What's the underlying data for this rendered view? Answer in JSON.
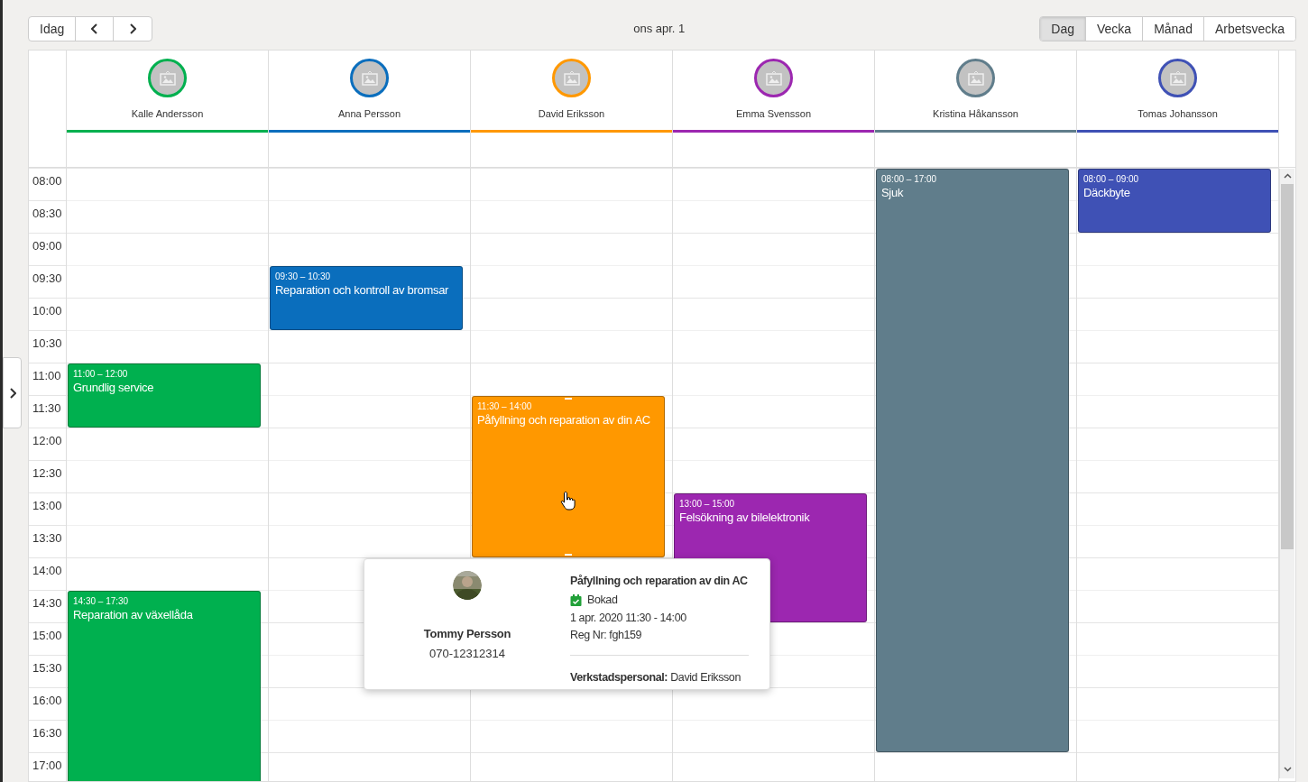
{
  "toolbar": {
    "today_button": "Idag",
    "date_label": "ons apr. 1",
    "views": [
      {
        "label": "Dag",
        "selected": true
      },
      {
        "label": "Vecka",
        "selected": false
      },
      {
        "label": "Månad",
        "selected": false
      },
      {
        "label": "Arbetsvecka",
        "selected": false
      }
    ]
  },
  "time_slots": [
    "08:00",
    "08:30",
    "09:00",
    "09:30",
    "10:00",
    "10:30",
    "11:00",
    "11:30",
    "12:00",
    "12:30",
    "13:00",
    "13:30",
    "14:00",
    "14:30",
    "15:00",
    "15:30",
    "16:00",
    "16:30",
    "17:00"
  ],
  "resources": [
    {
      "name": "Kalle Andersson",
      "color": "#00b04f",
      "events": [
        {
          "time": "11:00 – 12:00",
          "title": "Grundlig service"
        },
        {
          "time": "14:30 – 17:30",
          "title": "Reparation av växellåda"
        }
      ]
    },
    {
      "name": "Anna Persson",
      "color": "#0a6ebd",
      "events": [
        {
          "time": "09:30 – 10:30",
          "title": "Reparation och kontroll av bromsar"
        }
      ]
    },
    {
      "name": "David Eriksson",
      "color": "#ff9800",
      "events": [
        {
          "time": "11:30 – 14:00",
          "title": "Påfyllning och reparation av din AC",
          "hovered": true
        }
      ]
    },
    {
      "name": "Emma Svensson",
      "color": "#9c27b0",
      "events": [
        {
          "time": "13:00 – 15:00",
          "title": "Felsökning av bilelektronik"
        }
      ]
    },
    {
      "name": "Kristina Håkansson",
      "color": "#607d8b",
      "events": [
        {
          "time": "08:00 – 17:00",
          "title": "Sjuk"
        }
      ]
    },
    {
      "name": "Tomas Johansson",
      "color": "#3f51b5",
      "events": [
        {
          "time": "08:00 – 09:00",
          "title": "Däckbyte"
        }
      ]
    }
  ],
  "popup": {
    "customer_name": "Tommy Persson",
    "phone": "070-12312314",
    "title": "Påfyllning och reparation av din AC",
    "status": "Bokad",
    "datetime": "1 apr. 2020 11:30 - 14:00",
    "reg_nr": "Reg Nr: fgh159",
    "staff": "**Verkstadspersonal:** David Eriksson"
  }
}
